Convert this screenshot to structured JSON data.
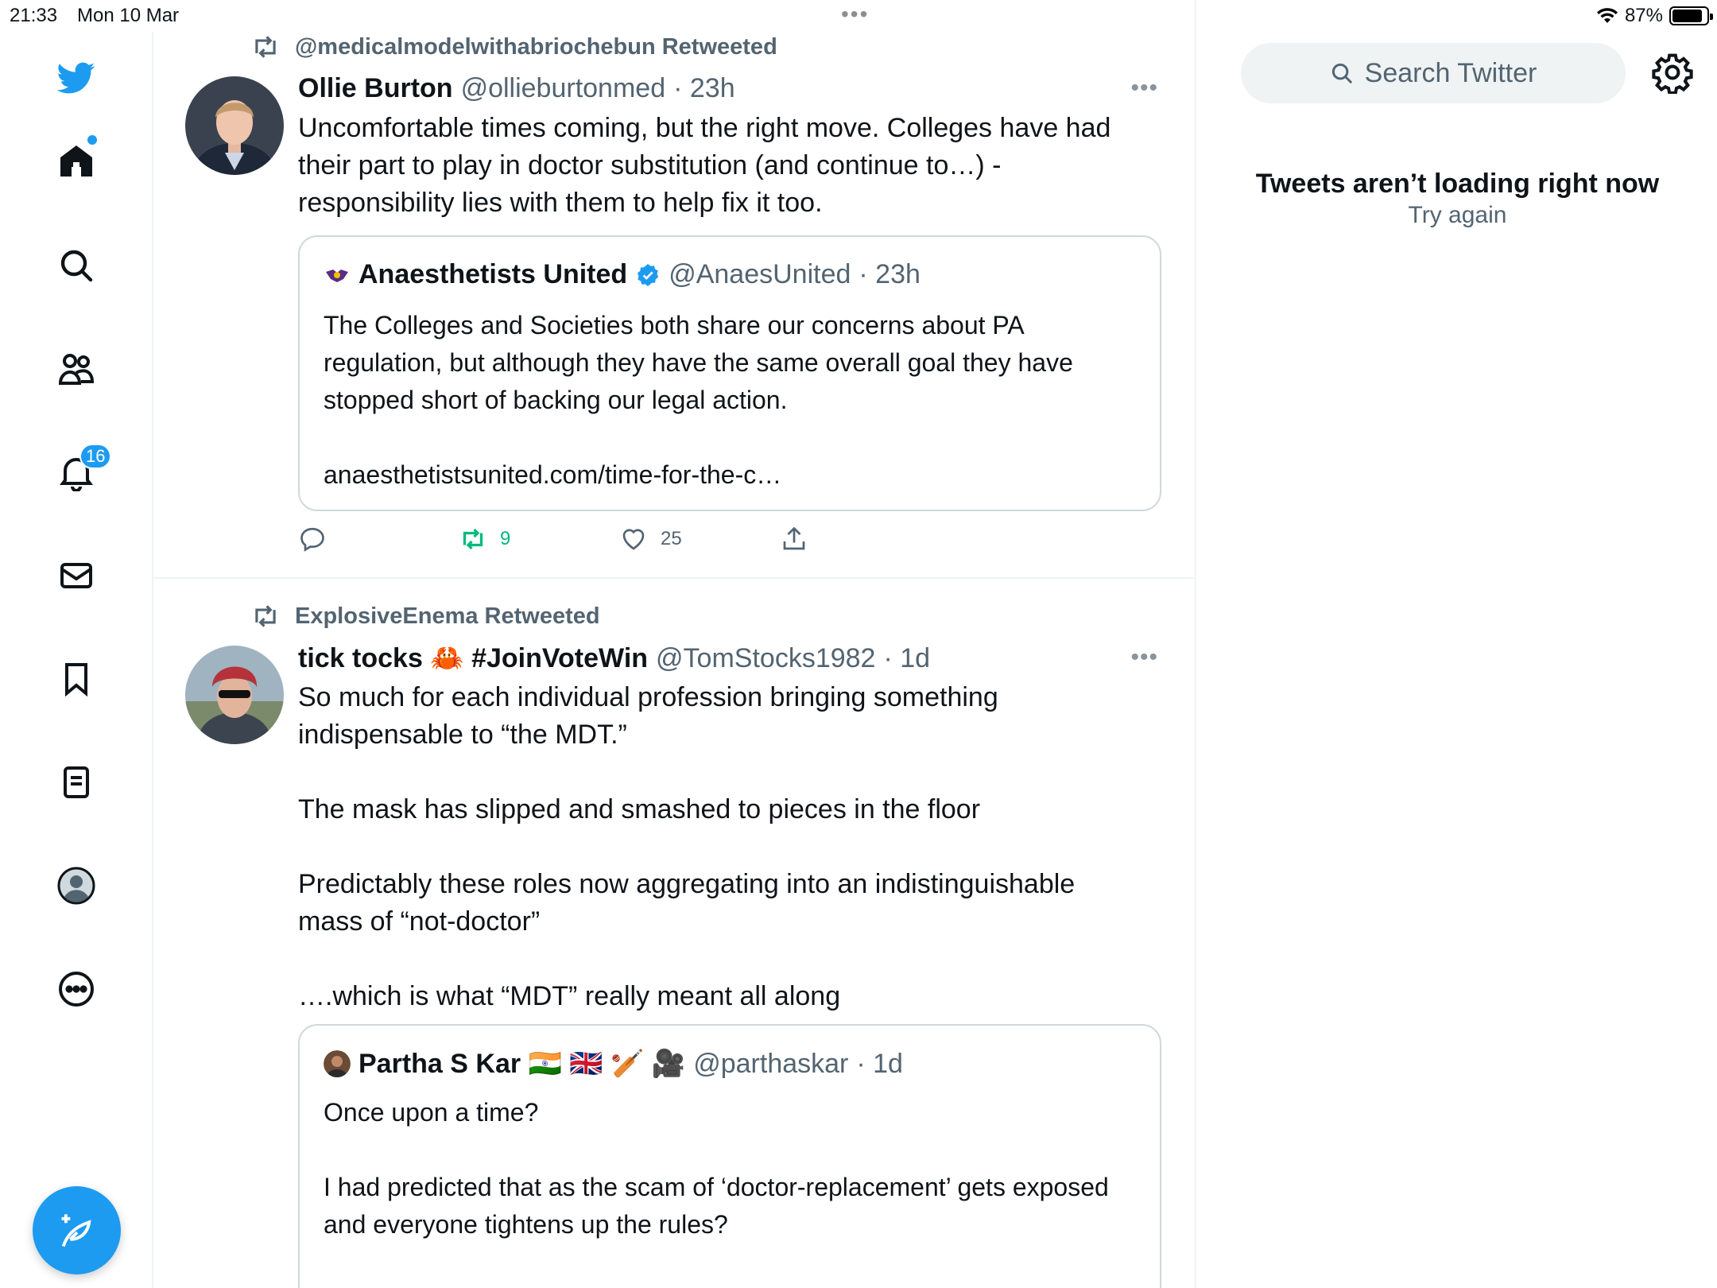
{
  "status_bar": {
    "time": "21:33",
    "date": "Mon 10 Mar",
    "battery": "87%"
  },
  "nav": {
    "icons": [
      "twitter-logo-icon",
      "home-icon",
      "search-icon",
      "communities-icon",
      "notifications-icon",
      "messages-icon",
      "bookmarks-icon",
      "lists-icon",
      "profile-icon",
      "more-icon"
    ],
    "notifications_badge": "16",
    "accent": "#1d9bf0"
  },
  "timeline": {
    "tweets": [
      {
        "retweeted_by": "@medicalmodelwithabriochebun Retweeted",
        "author": "Ollie Burton",
        "handle": "@ollieburtonmed",
        "time": "· 23h",
        "text": "Uncomfortable times coming, but the right move. Colleges have had their part to play in doctor substitution (and continue to…) - responsibility lies with them to help fix it too.",
        "quote": {
          "author": "Anaesthetists United",
          "handle": "@AnaesUnited",
          "time": "· 23h",
          "text": "The Colleges and Societies both share our concerns about PA regulation, but although they have the same overall goal they have stopped short of backing our legal action.\n\nanaesthetistsunited.com/time-for-the-c…"
        },
        "retweets": "9",
        "likes": "25"
      },
      {
        "retweeted_by": "ExplosiveEnema Retweeted",
        "author": "tick tocks 🦀 #JoinVoteWin",
        "handle": "@TomStocks1982",
        "time": "· 1d",
        "text": "So much for each individual profession bringing something indispensable to “the MDT.”\n\nThe mask has slipped and smashed to pieces in the floor\n\nPredictably these roles now aggregating into an indistinguishable mass of “not-doctor”\n\n….which is what “MDT” really meant all along",
        "quote": {
          "author": "Partha S Kar 🇮🇳 🇬🇧 🏏 🎥",
          "handle": "@parthaskar",
          "time": "· 1d",
          "text": "Once upon a time?\n\nI had predicted that as the scam of ‘doctor-replacement’ gets exposed and everyone tightens up the rules?"
        }
      }
    ]
  },
  "sidebar": {
    "search_placeholder": "Search Twitter",
    "empty_title": "Tweets aren’t loading right now",
    "retry": "Try again"
  }
}
